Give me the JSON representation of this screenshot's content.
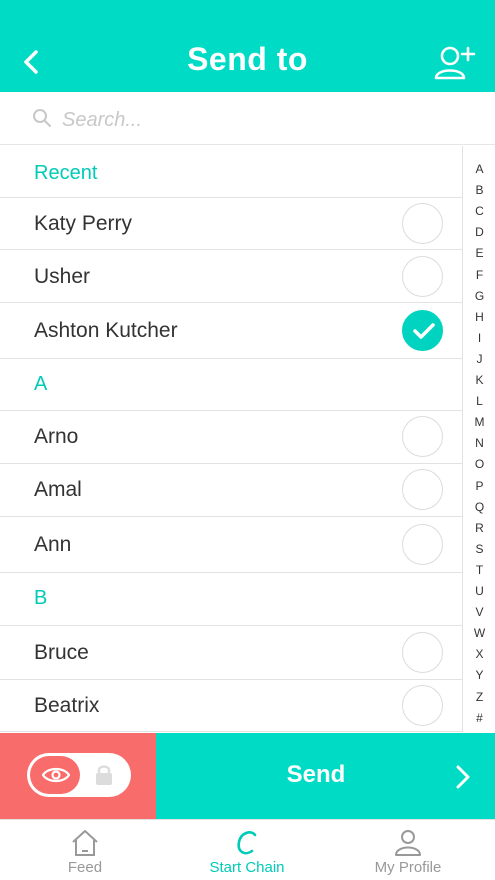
{
  "header": {
    "title": "Send to",
    "back_icon": "chevron-left-icon",
    "add_user_icon": "add-user-icon"
  },
  "search": {
    "placeholder": "Search...",
    "value": ""
  },
  "sections": [
    {
      "title": "Recent",
      "contacts": [
        {
          "name": "Katy Perry",
          "selected": false
        },
        {
          "name": "Usher",
          "selected": false
        },
        {
          "name": "Ashton Kutcher",
          "selected": true
        }
      ]
    },
    {
      "title": "A",
      "contacts": [
        {
          "name": "Arno",
          "selected": false
        },
        {
          "name": "Amal",
          "selected": false
        },
        {
          "name": "Ann",
          "selected": false
        }
      ]
    },
    {
      "title": "B",
      "contacts": [
        {
          "name": "Bruce",
          "selected": false
        },
        {
          "name": "Beatrix",
          "selected": false
        }
      ]
    }
  ],
  "index_letters": [
    "A",
    "B",
    "C",
    "D",
    "E",
    "F",
    "G",
    "H",
    "I",
    "J",
    "K",
    "L",
    "M",
    "N",
    "O",
    "P",
    "Q",
    "R",
    "S",
    "T",
    "U",
    "V",
    "W",
    "X",
    "Y",
    "Z",
    "#"
  ],
  "action_bar": {
    "send_label": "Send",
    "privacy_mode": "public",
    "eye_icon": "eye-icon",
    "lock_icon": "lock-icon",
    "arrow_icon": "chevron-right-icon"
  },
  "tabbar": {
    "tabs": [
      {
        "label": "Feed",
        "icon": "home-icon",
        "active": false
      },
      {
        "label": "Start Chain",
        "icon": "chain-c-icon",
        "active": true
      },
      {
        "label": "My Profile",
        "icon": "person-icon",
        "active": false
      }
    ]
  },
  "colors": {
    "accent": "#00dbc6",
    "accent_text": "#00cbb7",
    "privacy": "#f86c6c"
  }
}
